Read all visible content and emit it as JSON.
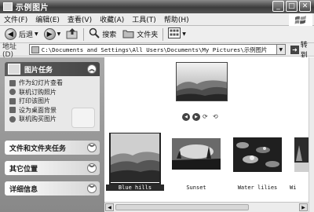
{
  "window": {
    "title": "示例图片",
    "min_glyph": "_",
    "max_glyph": "□",
    "close_glyph": "✕"
  },
  "menu": [
    "文件(F)",
    "编辑(E)",
    "查看(V)",
    "收藏(A)",
    "工具(T)",
    "帮助(H)"
  ],
  "toolbar": {
    "back": "后退",
    "search": "搜索",
    "folders": "文件夹"
  },
  "address": {
    "label": "地址(D)",
    "value": "C:\\Documents and Settings\\All Users\\Documents\\My Pictures\\示例图片",
    "go": "转到"
  },
  "tasks": {
    "picture_tasks": {
      "title": "图片任务",
      "items": [
        "作为幻灯片查看",
        "联机订购照片",
        "打印该图片",
        "设为桌面背景",
        "联机购买图片"
      ]
    },
    "file_folder_tasks": "文件和文件夹任务",
    "other_places": "其它位置",
    "details": "详细信息"
  },
  "files": [
    "Blue hills",
    "Sunset",
    "Water lilies",
    "Wi"
  ],
  "selected_file": "Blue hills",
  "icons": [
    "back-icon",
    "forward-icon",
    "up-folder-icon",
    "search-icon",
    "folders-icon",
    "views-icon",
    "go-icon",
    "previous-image-icon",
    "next-image-icon",
    "rotate-clockwise-icon",
    "rotate-counterclockwise-icon"
  ]
}
